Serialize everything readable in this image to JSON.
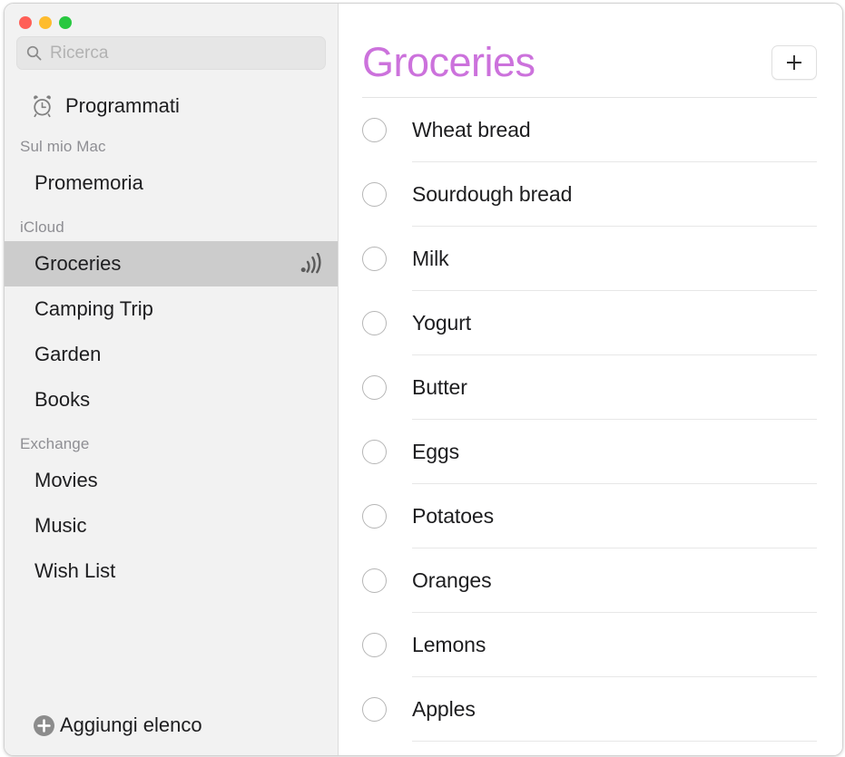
{
  "window": {
    "traffic_lights": [
      {
        "name": "close",
        "color": "#ff5f57"
      },
      {
        "name": "minimize",
        "color": "#febc2e"
      },
      {
        "name": "maximize",
        "color": "#28c840"
      }
    ]
  },
  "sidebar": {
    "search": {
      "placeholder": "Ricerca",
      "value": "",
      "icon": "search-icon"
    },
    "smart_list": {
      "label": "Programmati",
      "icon": "alarm-clock-icon"
    },
    "sections": [
      {
        "header": "Sul mio Mac",
        "items": [
          {
            "label": "Promemoria",
            "selected": false,
            "shared": false
          }
        ]
      },
      {
        "header": "iCloud",
        "items": [
          {
            "label": "Groceries",
            "selected": true,
            "shared": true
          },
          {
            "label": "Camping Trip",
            "selected": false,
            "shared": false
          },
          {
            "label": "Garden",
            "selected": false,
            "shared": false
          },
          {
            "label": "Books",
            "selected": false,
            "shared": false
          }
        ]
      },
      {
        "header": "Exchange",
        "items": [
          {
            "label": "Movies",
            "selected": false,
            "shared": false
          },
          {
            "label": "Music",
            "selected": false,
            "shared": false
          },
          {
            "label": "Wish List",
            "selected": false,
            "shared": false
          }
        ]
      }
    ],
    "add_list": {
      "label": "Aggiungi elenco",
      "icon": "plus-circle-icon"
    }
  },
  "main": {
    "title": "Groceries",
    "title_color": "#cc72dc",
    "add_button": {
      "icon": "plus-icon",
      "label": ""
    },
    "tasks": [
      {
        "label": "Wheat bread",
        "completed": false
      },
      {
        "label": "Sourdough bread",
        "completed": false
      },
      {
        "label": "Milk",
        "completed": false
      },
      {
        "label": "Yogurt",
        "completed": false
      },
      {
        "label": "Butter",
        "completed": false
      },
      {
        "label": "Eggs",
        "completed": false
      },
      {
        "label": "Potatoes",
        "completed": false
      },
      {
        "label": "Oranges",
        "completed": false
      },
      {
        "label": "Lemons",
        "completed": false
      },
      {
        "label": "Apples",
        "completed": false
      }
    ]
  }
}
